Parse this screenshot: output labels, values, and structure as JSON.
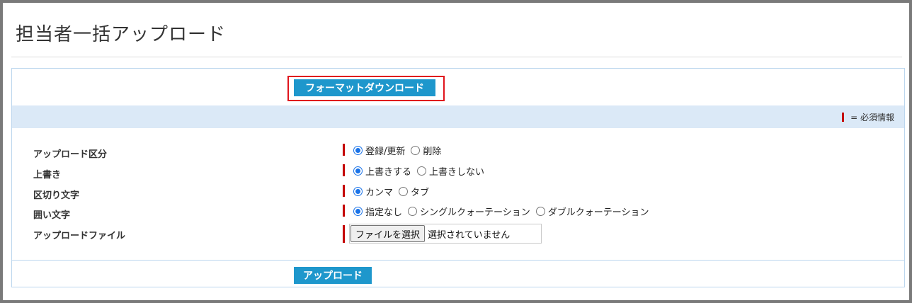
{
  "page": {
    "title": "担当者一括アップロード"
  },
  "buttons": {
    "format_download": "フォーマットダウンロード",
    "upload": "アップロード"
  },
  "legend": {
    "required_text": "= 必須情報",
    "required_color": "#c40000"
  },
  "form": {
    "upload_type": {
      "label": "アップロード区分",
      "options": [
        {
          "label": "登録/更新",
          "selected": true
        },
        {
          "label": "削除",
          "selected": false
        }
      ]
    },
    "overwrite": {
      "label": "上書き",
      "options": [
        {
          "label": "上書きする",
          "selected": true
        },
        {
          "label": "上書きしない",
          "selected": false
        }
      ]
    },
    "delimiter": {
      "label": "区切り文字",
      "options": [
        {
          "label": "カンマ",
          "selected": true
        },
        {
          "label": "タブ",
          "selected": false
        }
      ]
    },
    "enclosure": {
      "label": "囲い文字",
      "options": [
        {
          "label": "指定なし",
          "selected": true
        },
        {
          "label": "シングルクォーテーション",
          "selected": false
        },
        {
          "label": "ダブルクォーテーション",
          "selected": false
        }
      ]
    },
    "file": {
      "label": "アップロードファイル",
      "button_label": "ファイルを選択",
      "status": "選択されていません"
    }
  },
  "colors": {
    "accent": "#1e97cc",
    "band": "#dbe9f7",
    "highlight": "#e0141c"
  }
}
